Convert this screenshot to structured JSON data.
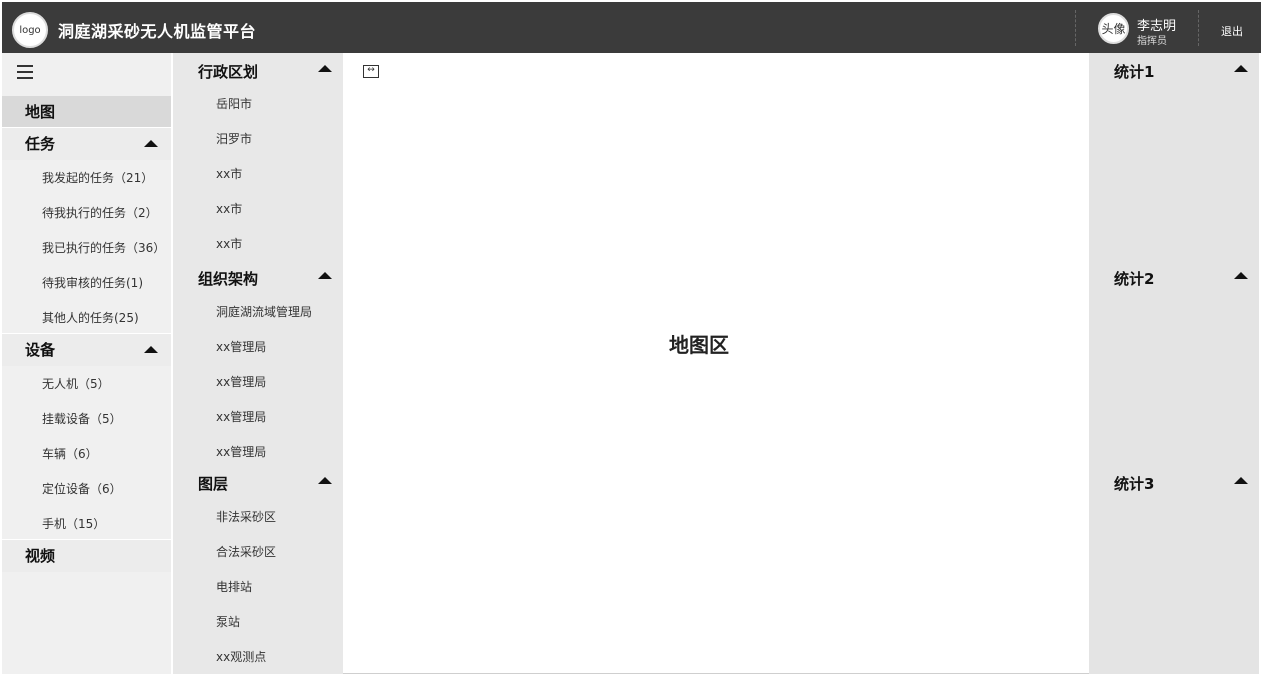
{
  "header": {
    "logo_text": "logo",
    "title": "洞庭湖采砂无人机监管平台",
    "avatar_text": "头像",
    "user_name": "李志明",
    "user_role": "指挥员",
    "logout_label": "退出",
    "colors": {
      "bar": "#3b3b3b",
      "text": "#ffffff"
    }
  },
  "sidebar": {
    "menu_icon": "hamburger-menu-icon",
    "map_label": "地图",
    "tasks": {
      "label": "任务",
      "items": [
        "我发起的任务（21）",
        "待我执行的任务（2）",
        "我已执行的任务（36）",
        "待我审核的任务(1)",
        "其他人的任务(25)"
      ]
    },
    "devices": {
      "label": "设备",
      "items": [
        "无人机（5）",
        "挂载设备（5）",
        "车辆（6）",
        "定位设备（6）",
        "手机（15）"
      ]
    },
    "video_label": "视频"
  },
  "tree": {
    "admin": {
      "label": "行政区划",
      "items": [
        "岳阳市",
        "汨罗市",
        "xx市",
        "xx市",
        "xx市"
      ]
    },
    "org": {
      "label": "组织架构",
      "items": [
        "洞庭湖流域管理局",
        "xx管理局",
        "xx管理局",
        "xx管理局",
        "xx管理局"
      ]
    },
    "layers": {
      "label": "图层",
      "items": [
        "非法采砂区",
        "合法采砂区",
        "电排站",
        "泵站",
        "xx观测点"
      ]
    }
  },
  "map": {
    "label": "地图区",
    "expand_icon": "expand-horizontal-icon"
  },
  "stats": {
    "items": [
      "统计1",
      "统计2",
      "统计3"
    ]
  }
}
